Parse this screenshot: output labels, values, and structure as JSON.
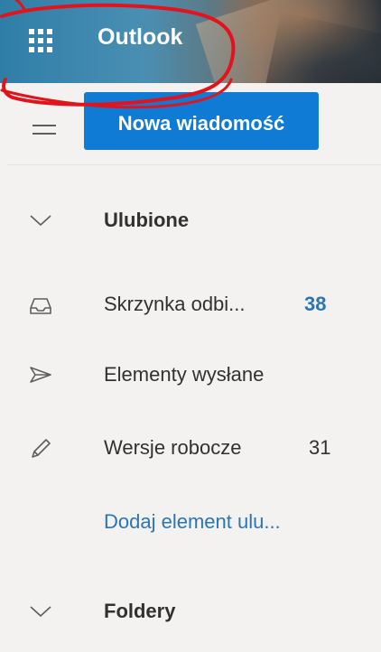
{
  "header": {
    "app_launcher_icon": "waffle-grid-icon",
    "app_name": "Outlook"
  },
  "toolbar": {
    "nav_toggle_icon": "hamburger-menu-icon",
    "new_message_label": "Nowa wiadomość"
  },
  "favorites": {
    "label": "Ulubione",
    "chevron_icon": "chevron-down-icon",
    "items": [
      {
        "label": "Skrzynka odbi...",
        "count": "38",
        "icon": "inbox-tray-icon",
        "count_color": "#2b75b5",
        "count_bold": true
      },
      {
        "label": "Elementy wysłane",
        "count": "",
        "icon": "send-arrow-icon"
      },
      {
        "label": "Wersje robocze",
        "count": "31",
        "icon": "pencil-icon",
        "count_color": "#323130",
        "count_bold": false
      }
    ],
    "add_link": "Dodaj element ulu..."
  },
  "folders": {
    "label": "Foldery",
    "chevron_icon": "chevron-down-icon"
  },
  "colors": {
    "accent": "#0f7bd4",
    "link": "#2b75b5",
    "annotation_red": "#e1141d",
    "pane_background": "#f3f2f1"
  }
}
